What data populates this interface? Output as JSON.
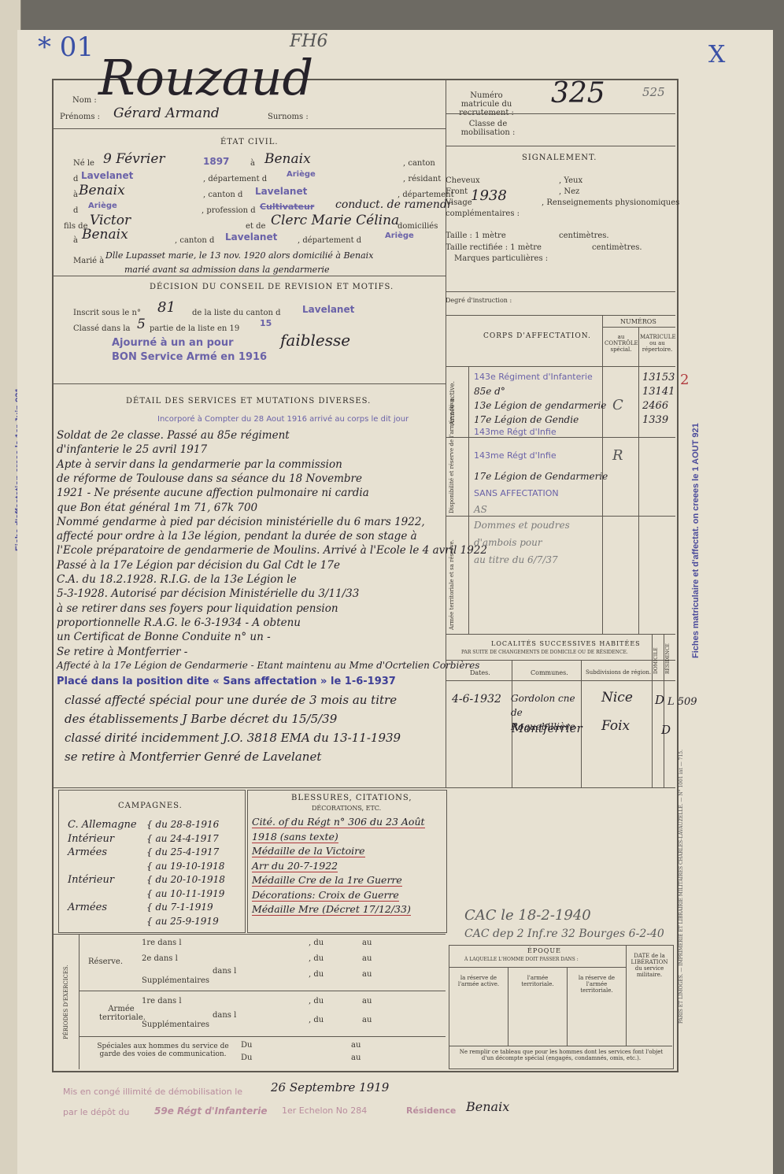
{
  "margin_marks": {
    "top_left": "* 01",
    "top_center": "FH6",
    "top_right": "X"
  },
  "left_stamp": "Fiche d'affectation creee le 1er Juin 921",
  "right_stamp": "Fiches matriculaire et d'affectat. on creees le 1 AOUT 921",
  "printer": "PARIS ET LIMOGES. — IMPRIMERIE ET LIBRAIRIE MILITAIRES CHARLES-LAVAUZELLE. — N° 1001 int — 715.",
  "identity": {
    "nom_label": "Nom :",
    "nom": "Rouzaud",
    "prenoms_label": "Prénoms :",
    "prenoms": "Gérard Armand",
    "surnoms_label": "Surnoms :"
  },
  "matricule": {
    "label": "Numéro matricule du recrutement :",
    "value": "325",
    "note": "525",
    "classe_label": "Classe de mobilisation :"
  },
  "etat_civil": {
    "title": "ÉTAT CIVIL.",
    "ne_le": "Né le",
    "date": "9 Février",
    "annee": "1897",
    "a": "à",
    "lieu": "Benaix",
    "canton": ", canton",
    "d1": "d",
    "canton_naissance": "Lavelanet",
    "departement_d": ", département d",
    "departement": "Ariège",
    "residant": ", résidant",
    "a2": "à",
    "residence": "Benaix",
    "canton_d": ", canton d",
    "canton_res": "Lavelanet",
    "departement2": ", département",
    "d2": "d",
    "dep_res": "Ariège",
    "profession_label": ", profession d",
    "profession_struck": "Cultivateur",
    "profession": "conduct. de ramendr",
    "fils_label": "fils de",
    "pere": "Victor",
    "mere_label": "et de",
    "mere": "Clerc Marie Célina",
    "domicilies": "domiciliés",
    "a3": "à",
    "domicile": "Benaix",
    "canton_d2": ", canton d",
    "canton_dom": "Lavelanet",
    "departement_d2": ", département d",
    "dep_dom": "Ariège",
    "marie_label": "Marié à",
    "marie": "Dlle Lupasset marie, le 13 nov. 1920 alors domicilié à Benaix",
    "marie_note": "marié avant sa admission dans la gendarmerie"
  },
  "signalement": {
    "title": "SIGNALEMENT.",
    "cheveux": "Cheveux",
    "yeux": ", Yeux",
    "front": "Front",
    "nez": ", Nez",
    "visage": "Visage",
    "visage_val": "1938",
    "renseignements": ", Renseignements physionomiques",
    "complementaires": "complémentaires :",
    "taille": "Taille : 1 mètre",
    "centimetres": "centimètres.",
    "taille_rect": "Taille rectifiée : 1 mètre",
    "centimetres2": "centimètres.",
    "marques": "Marques particulières :",
    "degre": "Degré d'instruction :"
  },
  "decision": {
    "title": "DÉCISION DU CONSEIL DE REVISION ET MOTIFS.",
    "inscrit": "Inscrit sous le n°",
    "num": "81",
    "de_liste": "de la liste du canton d",
    "canton": "Lavelanet",
    "classe_dans": "Classé dans la",
    "partie": "5",
    "partie_label": "partie de la liste en 19",
    "annee": "15",
    "stamp1": "Ajourné à un an pour",
    "motif": "faiblesse",
    "stamp2": "BON Service Armé en 1916"
  },
  "services": {
    "title": "DÉTAIL DES SERVICES ET MUTATIONS DIVERSES.",
    "incorpore": "Incorporé à Compter du 28 Aout 1916 arrivé au corps le dit jour",
    "lines": [
      "Soldat de 2e classe. Passé au 85e régiment",
      "d'infanterie le 25 avril 1917",
      "Apte à servir dans la gendarmerie par la commission",
      "de réforme de Toulouse dans sa séance du 18 Novembre",
      "1921 - Ne présente aucune affection pulmonaire ni cardia",
      "que Bon état général 1m 71, 67k 700",
      "Nommé gendarme à pied par décision ministérielle du 6 mars 1922,",
      "affecté pour ordre à la 13e légion, pendant la durée de son stage à",
      "l'Ecole préparatoire de gendarmerie de Moulins. Arrivé à l'Ecole le 4 avril 1922",
      "Passé à la 17e Légion par décision du Gal Cdt le 17e",
      "C.A. du 18.2.1928. R.I.G. de la 13e Légion le",
      "5-3-1928. Autorisé par décision Ministérielle du 3/11/33",
      "à se retirer dans ses foyers pour liquidation pension",
      "proportionnelle R.A.G. le 6-3-1934 - A obtenu",
      "un Certificat de Bonne Conduite n° un -",
      "Se retire à Montferrier -"
    ],
    "affecte": "Affecté à la 17e Légion de Gendarmerie - Etant maintenu au Mme d'Ocrtelien Corbières",
    "stamp_sans": "Placé dans la position dite « Sans affectation » le 1-6-1937",
    "lines2": [
      "classé affecté spécial pour une durée de 3 mois au titre",
      "des établissements J Barbe décret du 15/5/39",
      "classé dirité incidemment J.O. 3818 EMA du 13-11-1939",
      "se retire à Montferrier Genré de Lavelanet"
    ]
  },
  "corps": {
    "title": "CORPS D'AFFECTATION.",
    "numeros": "NUMÉROS",
    "col_controle": "au CONTRÔLE spécial.",
    "col_matricule": "MATRICULE ou au répertoire.",
    "side_active": "Armée active.",
    "side_dispo": "Disponibilité et réserve de l'armée active.",
    "side_terr": "Armée territoriale et sa réserve.",
    "rows": [
      {
        "corps": "143e Régiment d'Infanterie",
        "ctrl": "",
        "mat": "13153"
      },
      {
        "corps": "85e d°",
        "ctrl": "",
        "mat": "13141"
      },
      {
        "corps": "13e Légion de gendarmerie",
        "ctrl": "C",
        "mat": "2466"
      },
      {
        "corps": "17e Légion de Gendie",
        "ctrl": "",
        "mat": "1339"
      },
      {
        "corps": "143me Régt d'Infie",
        "ctrl": "",
        "mat": ""
      },
      {
        "corps": "143me Régt d'Infie",
        "ctrl": "R",
        "mat": ""
      },
      {
        "corps": "17e Légion de Gendarmerie",
        "ctrl": "",
        "mat": ""
      },
      {
        "corps": "SANS AFFECTATION",
        "ctrl": "",
        "mat": ""
      },
      {
        "corps": "AS",
        "ctrl": "",
        "mat": ""
      },
      {
        "corps": "Dommes et poudres",
        "ctrl": "",
        "mat": ""
      },
      {
        "corps": "d'ambois pour",
        "ctrl": "",
        "mat": ""
      },
      {
        "corps": "au titre du 6/7/37",
        "ctrl": "",
        "mat": ""
      }
    ],
    "red_mark": "2"
  },
  "localites": {
    "title": "LOCALITÉS SUCCESSIVES HABITÉES",
    "subtitle": "PAR SUITE DE CHANGEMENTS DE DOMICILE OU DE RÉSIDENCE.",
    "col_dates": "Dates.",
    "col_communes": "Communes.",
    "col_subdiv": "Subdivisions de région.",
    "col_dom": "DOMICILE",
    "col_res": "RÉSIDENCE",
    "rows": [
      {
        "date": "4-6-1932",
        "commune": "Gordolon cne de Roquebillière",
        "subdiv": "Nice",
        "mark": "D",
        "extra": "L 509"
      },
      {
        "date": "",
        "commune": "Montferrier",
        "subdiv": "Foix",
        "mark": "D",
        "extra": ""
      }
    ]
  },
  "campagnes": {
    "title": "CAMPAGNES.",
    "rows": [
      {
        "lieu": "C. Allemagne",
        "du": "du 28-8-1916"
      },
      {
        "lieu": "Intérieur",
        "du": "au 24-4-1917"
      },
      {
        "lieu": "Armées",
        "du": "du 25-4-1917"
      },
      {
        "lieu": "",
        "du": "au 19-10-1918"
      },
      {
        "lieu": "Intérieur",
        "du": "du 20-10-1918"
      },
      {
        "lieu": "",
        "du": "au 10-11-1919"
      },
      {
        "lieu": "Armées",
        "du": "du 7-1-1919"
      },
      {
        "lieu": "",
        "du": "au 25-9-1919"
      }
    ]
  },
  "blessures": {
    "title": "BLESSURES, CITATIONS,",
    "subtitle": "DÉCORATIONS, ETC.",
    "lines": [
      "Cité. of du Régt n° 306 du 23 Août",
      "1918 (sans texte)",
      "Médaille de la Victoire",
      "Arr du 20-7-1922",
      "Médaille Cre de la 1re Guerre",
      "Décorations: Croix de Guerre",
      "Médaille Mre (Décret 17/12/33)"
    ]
  },
  "cac": {
    "line1": "CAC le 18-2-1940",
    "line2": "CAC dep 2 Inf.re 32 Bourges 6-2-40"
  },
  "periodes": {
    "side": "PÉRIODES D'EXERCICES.",
    "reserve": "Réserve.",
    "terr": "Armée territoriale.",
    "premier": "1re dans l",
    "deuxieme": "2e dans l",
    "supp": "Supplémentaires",
    "dans": "dans l",
    "du": ", du",
    "au": "au",
    "speciales": "Spéciales aux hommes du service de garde des voies de communication.",
    "du2": "Du",
    "au2": "au"
  },
  "epoque": {
    "title": "ÉPOQUE",
    "subtitle": "À LAQUELLE L'HOMME DOIT PASSER DANS :",
    "c1": "la réserve de l'armée active.",
    "c2": "l'armée territoriale.",
    "c3": "la réserve de l'armée territoriale.",
    "c4": "DATE de la LIBÉRATION du service militaire.",
    "note": "Ne remplir ce tableau que pour les hommes dont les services font l'objet d'un décompte spécial (engagés, condamnés, omis, etc.)."
  },
  "bottom": {
    "line1_stamp": "Mis en congé illimité de démobilisation le",
    "line1_date": "26 Septembre 1919",
    "line2_stamp": "par le dépôt du",
    "line2_regt": "59e Régt d'Infanterie",
    "line2_echelon": "1er Echelon No 284",
    "line2_res": "Résidence",
    "line2_lieu": "Benaix"
  }
}
